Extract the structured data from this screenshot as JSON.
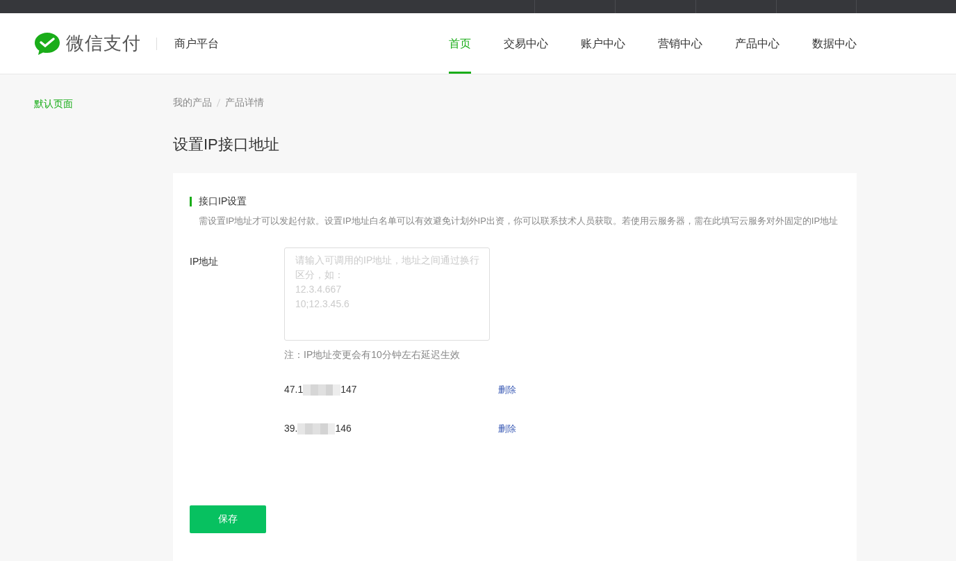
{
  "header": {
    "brand": "微信支付",
    "platform": "商户平台",
    "nav": [
      {
        "label": "首页",
        "selected": true
      },
      {
        "label": "交易中心",
        "selected": false
      },
      {
        "label": "账户中心",
        "selected": false
      },
      {
        "label": "营销中心",
        "selected": false
      },
      {
        "label": "产品中心",
        "selected": false
      },
      {
        "label": "数据中心",
        "selected": false
      }
    ]
  },
  "sidebar": {
    "items": [
      {
        "label": "默认页面",
        "selected": true
      }
    ]
  },
  "breadcrumb": [
    "我的产品",
    "产品详情"
  ],
  "page_title": "设置IP接口地址",
  "section": {
    "title": "接口IP设置",
    "description": "需设置IP地址才可以发起付款。设置IP地址白名单可以有效避免计划外IP出资，你可以联系技术人员获取。若使用云服务器，需在此填写云服务对外固定的IP地址",
    "field_label": "IP地址",
    "placeholder": "请输入可调用的IP地址，地址之间通过换行区分，如：\n12.3.4.667\n10;12.3.45.6",
    "note": "注：IP地址变更会有10分钟左右延迟生效",
    "ips": [
      {
        "prefix": "47.1",
        "suffix": "147",
        "action": "删除"
      },
      {
        "prefix": "39.",
        "suffix": "146",
        "action": "删除"
      }
    ],
    "save": "保存"
  }
}
